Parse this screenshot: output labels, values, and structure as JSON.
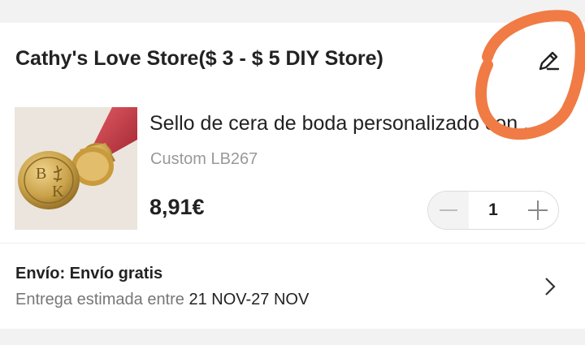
{
  "store": {
    "title": "Cathy's Love Store($ 3 - $ 5 DIY Store)"
  },
  "product": {
    "title": "Sello de cera de boda personalizado con ...",
    "variant": "Custom LB267",
    "price": "8,91€",
    "image_monogram_top": "B",
    "image_monogram_bottom": "K"
  },
  "quantity": {
    "value": "1"
  },
  "shipping": {
    "label": "Envío: Envío gratis",
    "delivery_prefix": "Entrega estimada entre",
    "delivery_dates": "21 NOV-27 NOV"
  },
  "icons": {
    "edit": "pencil-icon",
    "decrease": "minus-icon",
    "increase": "plus-icon",
    "navigate": "chevron-right-icon"
  },
  "colors": {
    "annotation": "#f07b45",
    "seal_gold": "#c9a24a",
    "handle_red": "#c83a44"
  }
}
